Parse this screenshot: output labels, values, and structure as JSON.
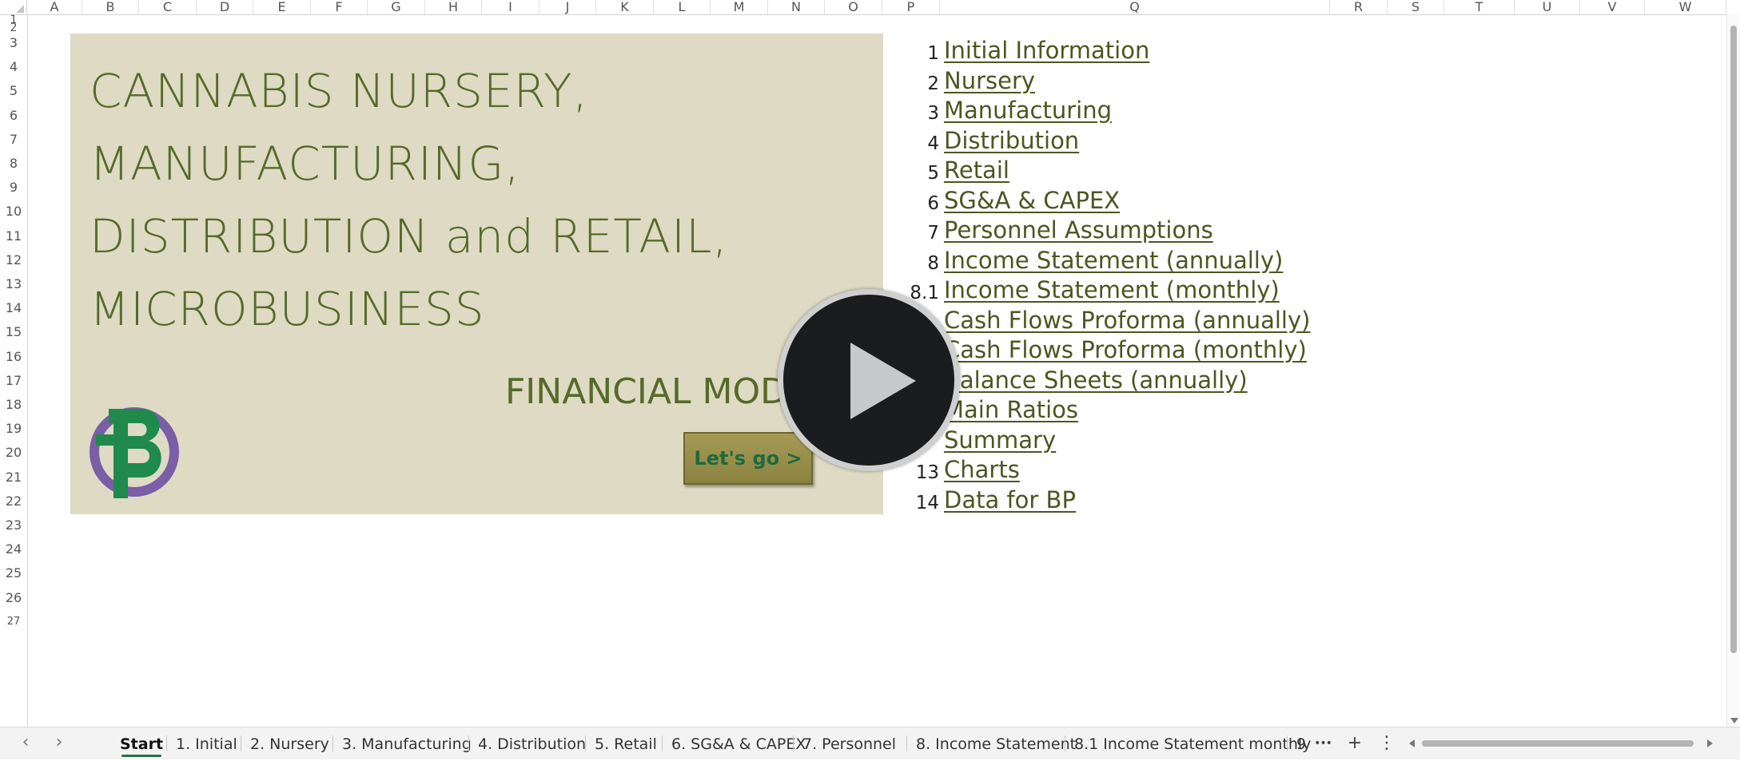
{
  "columns": [
    "A",
    "B",
    "C",
    "D",
    "E",
    "F",
    "G",
    "H",
    "I",
    "J",
    "K",
    "L",
    "M",
    "N",
    "O",
    "P",
    "Q",
    "R",
    "S",
    "T",
    "U",
    "V",
    "W"
  ],
  "rows": [
    "1",
    "2",
    "3",
    "4",
    "5",
    "6",
    "7",
    "8",
    "9",
    "10",
    "11",
    "12",
    "13",
    "14",
    "15",
    "16",
    "17",
    "18",
    "19",
    "20",
    "21",
    "22",
    "23",
    "24",
    "25",
    "26",
    "27"
  ],
  "banner": {
    "title_lines": [
      "CANNABIS NURSERY,",
      "MANUFACTURING,",
      "DISTRIBUTION and RETAIL,",
      "MICROBUSINESS"
    ],
    "subtitle": "FINANCIAL MOD",
    "button_label": "Let's go >"
  },
  "toc": [
    {
      "num": "1",
      "label": "Initial Information"
    },
    {
      "num": "2",
      "label": "Nursery"
    },
    {
      "num": "3",
      "label": "Manufacturing"
    },
    {
      "num": "4",
      "label": "Distribution"
    },
    {
      "num": "5",
      "label": "Retail"
    },
    {
      "num": "6",
      "label": "SG&A & CAPEX"
    },
    {
      "num": "7",
      "label": "Personnel Assumptions"
    },
    {
      "num": "8",
      "label": "Income Statement (annually)"
    },
    {
      "num": "8.1",
      "label": "Income Statement (monthly)"
    },
    {
      "num": "",
      "label": "Cash Flows Proforma (annually)"
    },
    {
      "num": "",
      "label": "Cash Flows Proforma (monthly)"
    },
    {
      "num": "",
      "label": "Balance Sheets (annually)"
    },
    {
      "num": "",
      "label": "Main Ratios"
    },
    {
      "num": "",
      "label": "Summary"
    },
    {
      "num": "13",
      "label": "Charts"
    },
    {
      "num": "14",
      "label": "Data for BP"
    }
  ],
  "video": {
    "icon": "play-icon"
  },
  "sheet_tabs": [
    "Start",
    "1. Initial",
    "2. Nursery",
    "3. Manufacturing",
    "4. Distribution",
    "5. Retail",
    "6. SG&A & CAPEX",
    "7. Personnel",
    "8. Income Statement",
    "8.1 Income Statement monthly",
    "9"
  ],
  "active_tab": "Start",
  "tab_controls": {
    "more": "•••",
    "add": "+",
    "options": "⋮",
    "prev": "‹",
    "next": "›"
  },
  "colors": {
    "banner_bg": "#dedac4",
    "title_green": "#556a28",
    "link": "#4b5620",
    "button_text": "#1e6a3d",
    "tab_active": "#217346"
  }
}
